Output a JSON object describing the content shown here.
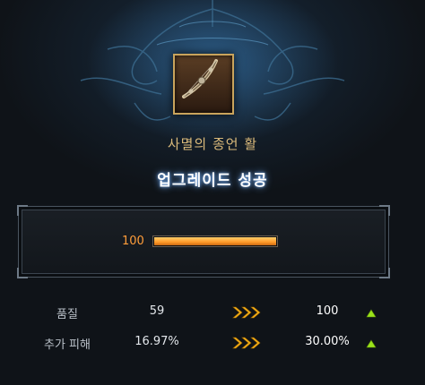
{
  "item": {
    "name": "사멸의 종언 활",
    "icon": "bow-icon"
  },
  "upgrade": {
    "result": "업그레이드 성공",
    "level_label": "100",
    "progress": 1.0
  },
  "stats": [
    {
      "label": "품질",
      "old": "59",
      "new": "100"
    },
    {
      "label": "추가 피해",
      "old": "16.97%",
      "new": "30.00%"
    }
  ],
  "colors": {
    "accent_orange": "#ff9d3a",
    "title_gold": "#d9b97a",
    "up_green": "#9be21a",
    "arrow_gold": "#f5b21b"
  }
}
